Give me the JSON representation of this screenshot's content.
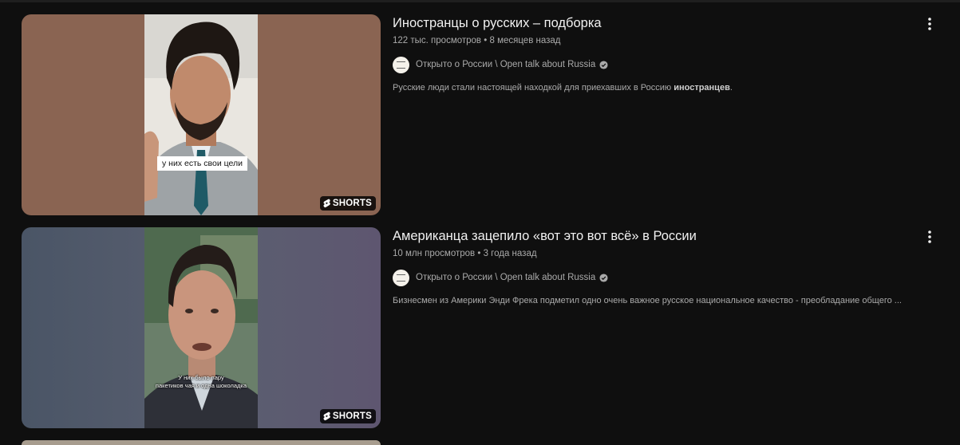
{
  "colors": {
    "background": "#0f0f0f",
    "text_primary": "#f1f1f1",
    "text_secondary": "#aaaaaa"
  },
  "results": [
    {
      "title": "Иностранцы о русских – подборка",
      "views": "122 тыс. просмотров",
      "age": "8 месяцев назад",
      "channel": "Открыто о России \\ Open talk about Russia",
      "description_prefix": "Русские люди стали настоящей находкой для приехавших в Россию ",
      "description_highlight": "иностранцев",
      "description_suffix": ".",
      "caption": "у них есть свои цели",
      "badge": "SHORTS"
    },
    {
      "title": "Американца зацепило «вот это вот всё» в России",
      "views": "10 млн просмотров",
      "age": "3 года назад",
      "channel": "Открыто о России \\ Open talk about Russia",
      "description_prefix": "Бизнесмен из Америки Энди Фрека подметил одно очень важное русское национальное качество - преобладание общего ...",
      "description_highlight": "",
      "description_suffix": "",
      "caption_line1": "У них было пару",
      "caption_line2": "пакетиков чая и одна шоколадка",
      "badge": "SHORTS"
    }
  ],
  "icons": {
    "more": "more-vert-icon",
    "verified": "verified-check-icon",
    "shorts": "shorts-logo-icon"
  }
}
